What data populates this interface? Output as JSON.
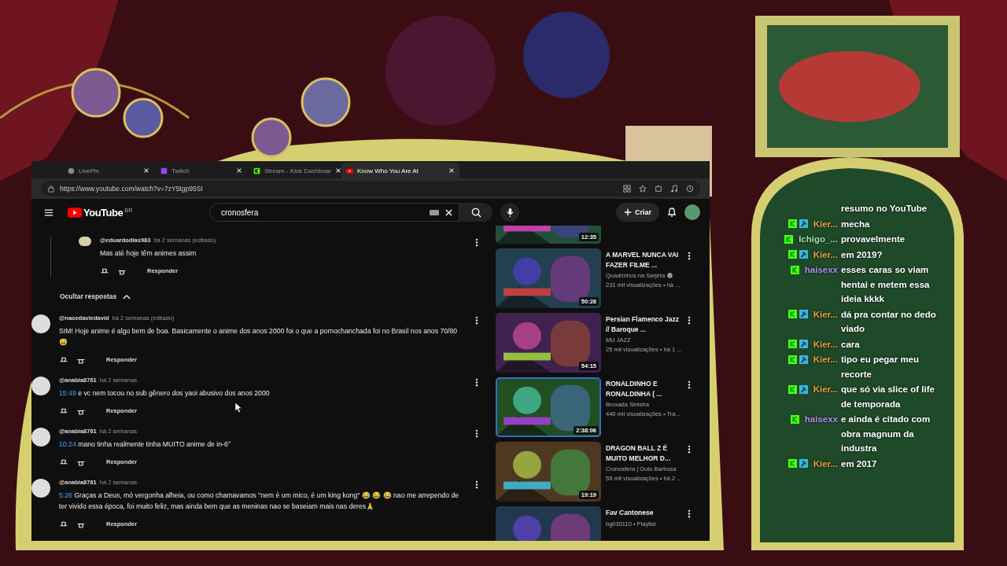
{
  "browser": {
    "tabs": [
      {
        "title": "LivePix",
        "kind": "generic",
        "selected": false
      },
      {
        "title": "Twitch",
        "kind": "twitch",
        "selected": false
      },
      {
        "title": "Stream - Kick Dashboar",
        "kind": "kick",
        "selected": false
      },
      {
        "title": "Know Who You Are At",
        "kind": "youtube",
        "selected": true
      }
    ],
    "url": "https://www.youtube.com/watch?v=7zY5tgp95SI"
  },
  "youtube": {
    "logo": "YouTube",
    "region": "BR",
    "search": {
      "value": "cronosfera"
    },
    "create_button": "Criar"
  },
  "comments": [
    {
      "kind": "reply",
      "author": "@eduardodias983",
      "time": "há 2 semanas (editado)",
      "text": "Mas até hoje têm animes assim",
      "action": "Responder"
    },
    {
      "kind": "toggle",
      "label": "Ocultar respostas"
    },
    {
      "kind": "comment",
      "author": "@naoedaviedavid",
      "time": "há 2 semanas (editado)",
      "text": "SIM! Hoje anime é algo bem de boa. Basicamente o anime dos anos 2000 foi o que a pornochanchada foi no Brasil nos anos 70/80 😅",
      "action": "Responder"
    },
    {
      "kind": "comment",
      "author": "@anabia8761",
      "time": "há 2 semanas",
      "timestamp": "15:49",
      "text": "e vc nem tocou no sub gênero dos yaoi abusivo dos anos 2000",
      "action": "Responder"
    },
    {
      "kind": "comment",
      "author": "@anabia8761",
      "time": "há 2 semanas",
      "timestamp": "10:24",
      "text": "mano tinha realmente tinha MUITO anime de in-6°",
      "action": "Responder"
    },
    {
      "kind": "comment",
      "author": "@anabia8761",
      "time": "há 2 semanas",
      "timestamp": "5:26",
      "text": "Graças a Deus, mó vergonha alheia, ou como chamavamos \"nem é um mico, é um king kong\" 😂 😂 😂  nao me arrependo de ter vivido essa época, foi muito feliz, mas ainda bem que as meninas nao se baseiam mais nas deres🙏",
      "action": "Responder"
    }
  ],
  "sidebar_videos": [
    {
      "kind": "partial",
      "duration": "12:35",
      "highlighted": false
    },
    {
      "kind": "video",
      "title": "A MARVEL NUNCA VAI FAZER FILME ...",
      "channel": "Quadrinhos na Sarjeta",
      "verified": true,
      "meta": "231 mil visualizações • há ...",
      "duration": "50:28",
      "highlighted": false
    },
    {
      "kind": "video",
      "title": "Persian Flamenco Jazz // Baroque ...",
      "channel": "MU JAZZ",
      "verified": false,
      "meta": "25 mil visualizações • há 1 ...",
      "duration": "54:15",
      "highlighted": false
    },
    {
      "kind": "video",
      "title": "RONALDINHO E RONALDINHA ( ...",
      "channel": "Broxada Sinistra",
      "verified": false,
      "meta": "440 mil visualizações • Tra...",
      "duration": "2:38:06",
      "highlighted": true
    },
    {
      "kind": "video",
      "title": "DRAGON BALL Z É MUITO MELHOR D...",
      "channel": "Cronosfera | Guto Barbosa",
      "verified": false,
      "meta": "55 mil visualizações • há 2 ...",
      "duration": "19:19",
      "highlighted": false
    },
    {
      "kind": "playlist",
      "title": "Fav Cantonese",
      "meta": "bg030110 • Playlist",
      "highlighted": false
    }
  ],
  "chat": [
    {
      "kind": "continuation",
      "text": "resumo no YouTube"
    },
    {
      "kind": "message",
      "user": "Kier...",
      "color": "#e9a23b",
      "moderator": true,
      "text": "mecha"
    },
    {
      "kind": "message",
      "user": "Ichigo_...",
      "color": "#9fe0b0",
      "moderator": false,
      "text": "provavelmente"
    },
    {
      "kind": "message",
      "user": "Kier...",
      "color": "#e9a23b",
      "moderator": true,
      "text": "em 2019?"
    },
    {
      "kind": "message",
      "user": "haisexx",
      "color": "#b48cf0",
      "moderator": false,
      "text": "esses caras so viam hentai e metem essa ideia kkkk"
    },
    {
      "kind": "message",
      "user": "Kier...",
      "color": "#e9a23b",
      "moderator": true,
      "text": "dá pra contar no dedo viado"
    },
    {
      "kind": "message",
      "user": "Kier...",
      "color": "#e9a23b",
      "moderator": true,
      "text": "cara"
    },
    {
      "kind": "message",
      "user": "Kier...",
      "color": "#e9a23b",
      "moderator": true,
      "text": "tipo eu pegar meu recorte"
    },
    {
      "kind": "message",
      "user": "Kier...",
      "color": "#e9a23b",
      "moderator": true,
      "text": "que só via slice of life de temporada"
    },
    {
      "kind": "message",
      "user": "haisexx",
      "color": "#b48cf0",
      "moderator": false,
      "text": "e ainda é citado com obra magnum da industra"
    },
    {
      "kind": "message",
      "user": "Kier...",
      "color": "#e9a23b",
      "moderator": true,
      "text": "em 2017"
    }
  ]
}
